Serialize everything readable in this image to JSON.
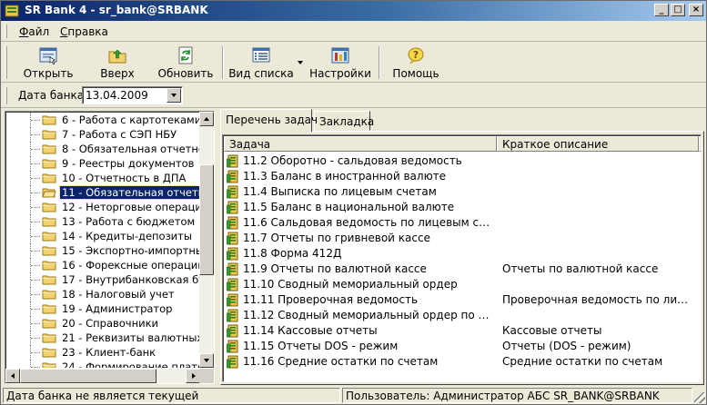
{
  "window": {
    "title": "SR Bank 4 - sr_bank@SRBANK",
    "minimize_glyph": "_",
    "maximize_glyph": "□",
    "close_glyph": "×"
  },
  "menu": {
    "items": [
      {
        "label": "Файл"
      },
      {
        "label": "Справка"
      }
    ]
  },
  "toolbar": {
    "buttons": [
      {
        "label": "Открыть",
        "icon": "open-icon"
      },
      {
        "label": "Вверх",
        "icon": "folder-up-icon"
      },
      {
        "label": "Обновить",
        "icon": "refresh-icon"
      },
      {
        "label": "Вид списка",
        "icon": "list-view-icon"
      },
      {
        "label": "Настройки",
        "icon": "settings-icon"
      },
      {
        "label": "Помощь",
        "icon": "help-icon"
      }
    ]
  },
  "datebar": {
    "label": "Дата банка:",
    "value": "13.04.2009"
  },
  "tree": {
    "items": [
      {
        "label": "6 - Работа с картотеками"
      },
      {
        "label": "7 - Работа с СЭП НБУ"
      },
      {
        "label": "8 - Обязательная отчетно"
      },
      {
        "label": "9 - Реестры документов"
      },
      {
        "label": "10 - Отчетность в ДПА"
      },
      {
        "label": "11 - Обязательная отчетн",
        "selected": true
      },
      {
        "label": "12 - Неторговые операци"
      },
      {
        "label": "13 - Работа с бюджетом"
      },
      {
        "label": "14 - Кредиты-депозиты"
      },
      {
        "label": "15 - Экспортно-импортные"
      },
      {
        "label": "16 - Форексные операции"
      },
      {
        "label": "17 - Внутрибанковская бух"
      },
      {
        "label": "18 - Налоговый учет"
      },
      {
        "label": "19 - Администратор"
      },
      {
        "label": "20 - Справочники"
      },
      {
        "label": "21 - Реквизиты валютных п"
      },
      {
        "label": "23 - Клиент-банк"
      },
      {
        "label": "24 - Формирование платеж"
      }
    ]
  },
  "tabs": [
    {
      "label": "Перечень задач",
      "active": true
    },
    {
      "label": "Закладка",
      "active": false
    }
  ],
  "list": {
    "columns": [
      "Задача",
      "Краткое описание"
    ],
    "rows": [
      {
        "name": "11.2 Оборотно - сальдовая ведомость",
        "desc": ""
      },
      {
        "name": "11.3 Баланс в иностранной валюте",
        "desc": ""
      },
      {
        "name": "11.4 Выписка по лицевым счетам",
        "desc": ""
      },
      {
        "name": "11.5 Баланс в национальной валюте",
        "desc": ""
      },
      {
        "name": "11.6 Сальдовая ведомость по лицевым счетам",
        "desc": ""
      },
      {
        "name": "11.7 Отчеты по гривневой кассе",
        "desc": ""
      },
      {
        "name": "11.8 Форма 412Д",
        "desc": ""
      },
      {
        "name": "11.9 Отчеты по валютной кассе",
        "desc": "Отчеты по валютной кассе"
      },
      {
        "name": "11.10 Сводный мемориальный ордер",
        "desc": ""
      },
      {
        "name": "11.11 Проверочная ведомость",
        "desc": "Проверочная ведомость по лицеві..."
      },
      {
        "name": "11.12 Сводный мемориальный ордер по пере...",
        "desc": ""
      },
      {
        "name": "11.14  Кассовые отчеты",
        "desc": "Кассовые отчеты"
      },
      {
        "name": "11.15 Отчеты DOS - режим",
        "desc": "Отчеты (DOS - режим)"
      },
      {
        "name": "11.16  Средние остатки по счетам",
        "desc": "Средние остатки по счетам"
      }
    ]
  },
  "status": {
    "left": "Дата банка не является текущей",
    "right": "Пользователь: Администратор АБС SR_BANK@SRBANK"
  }
}
